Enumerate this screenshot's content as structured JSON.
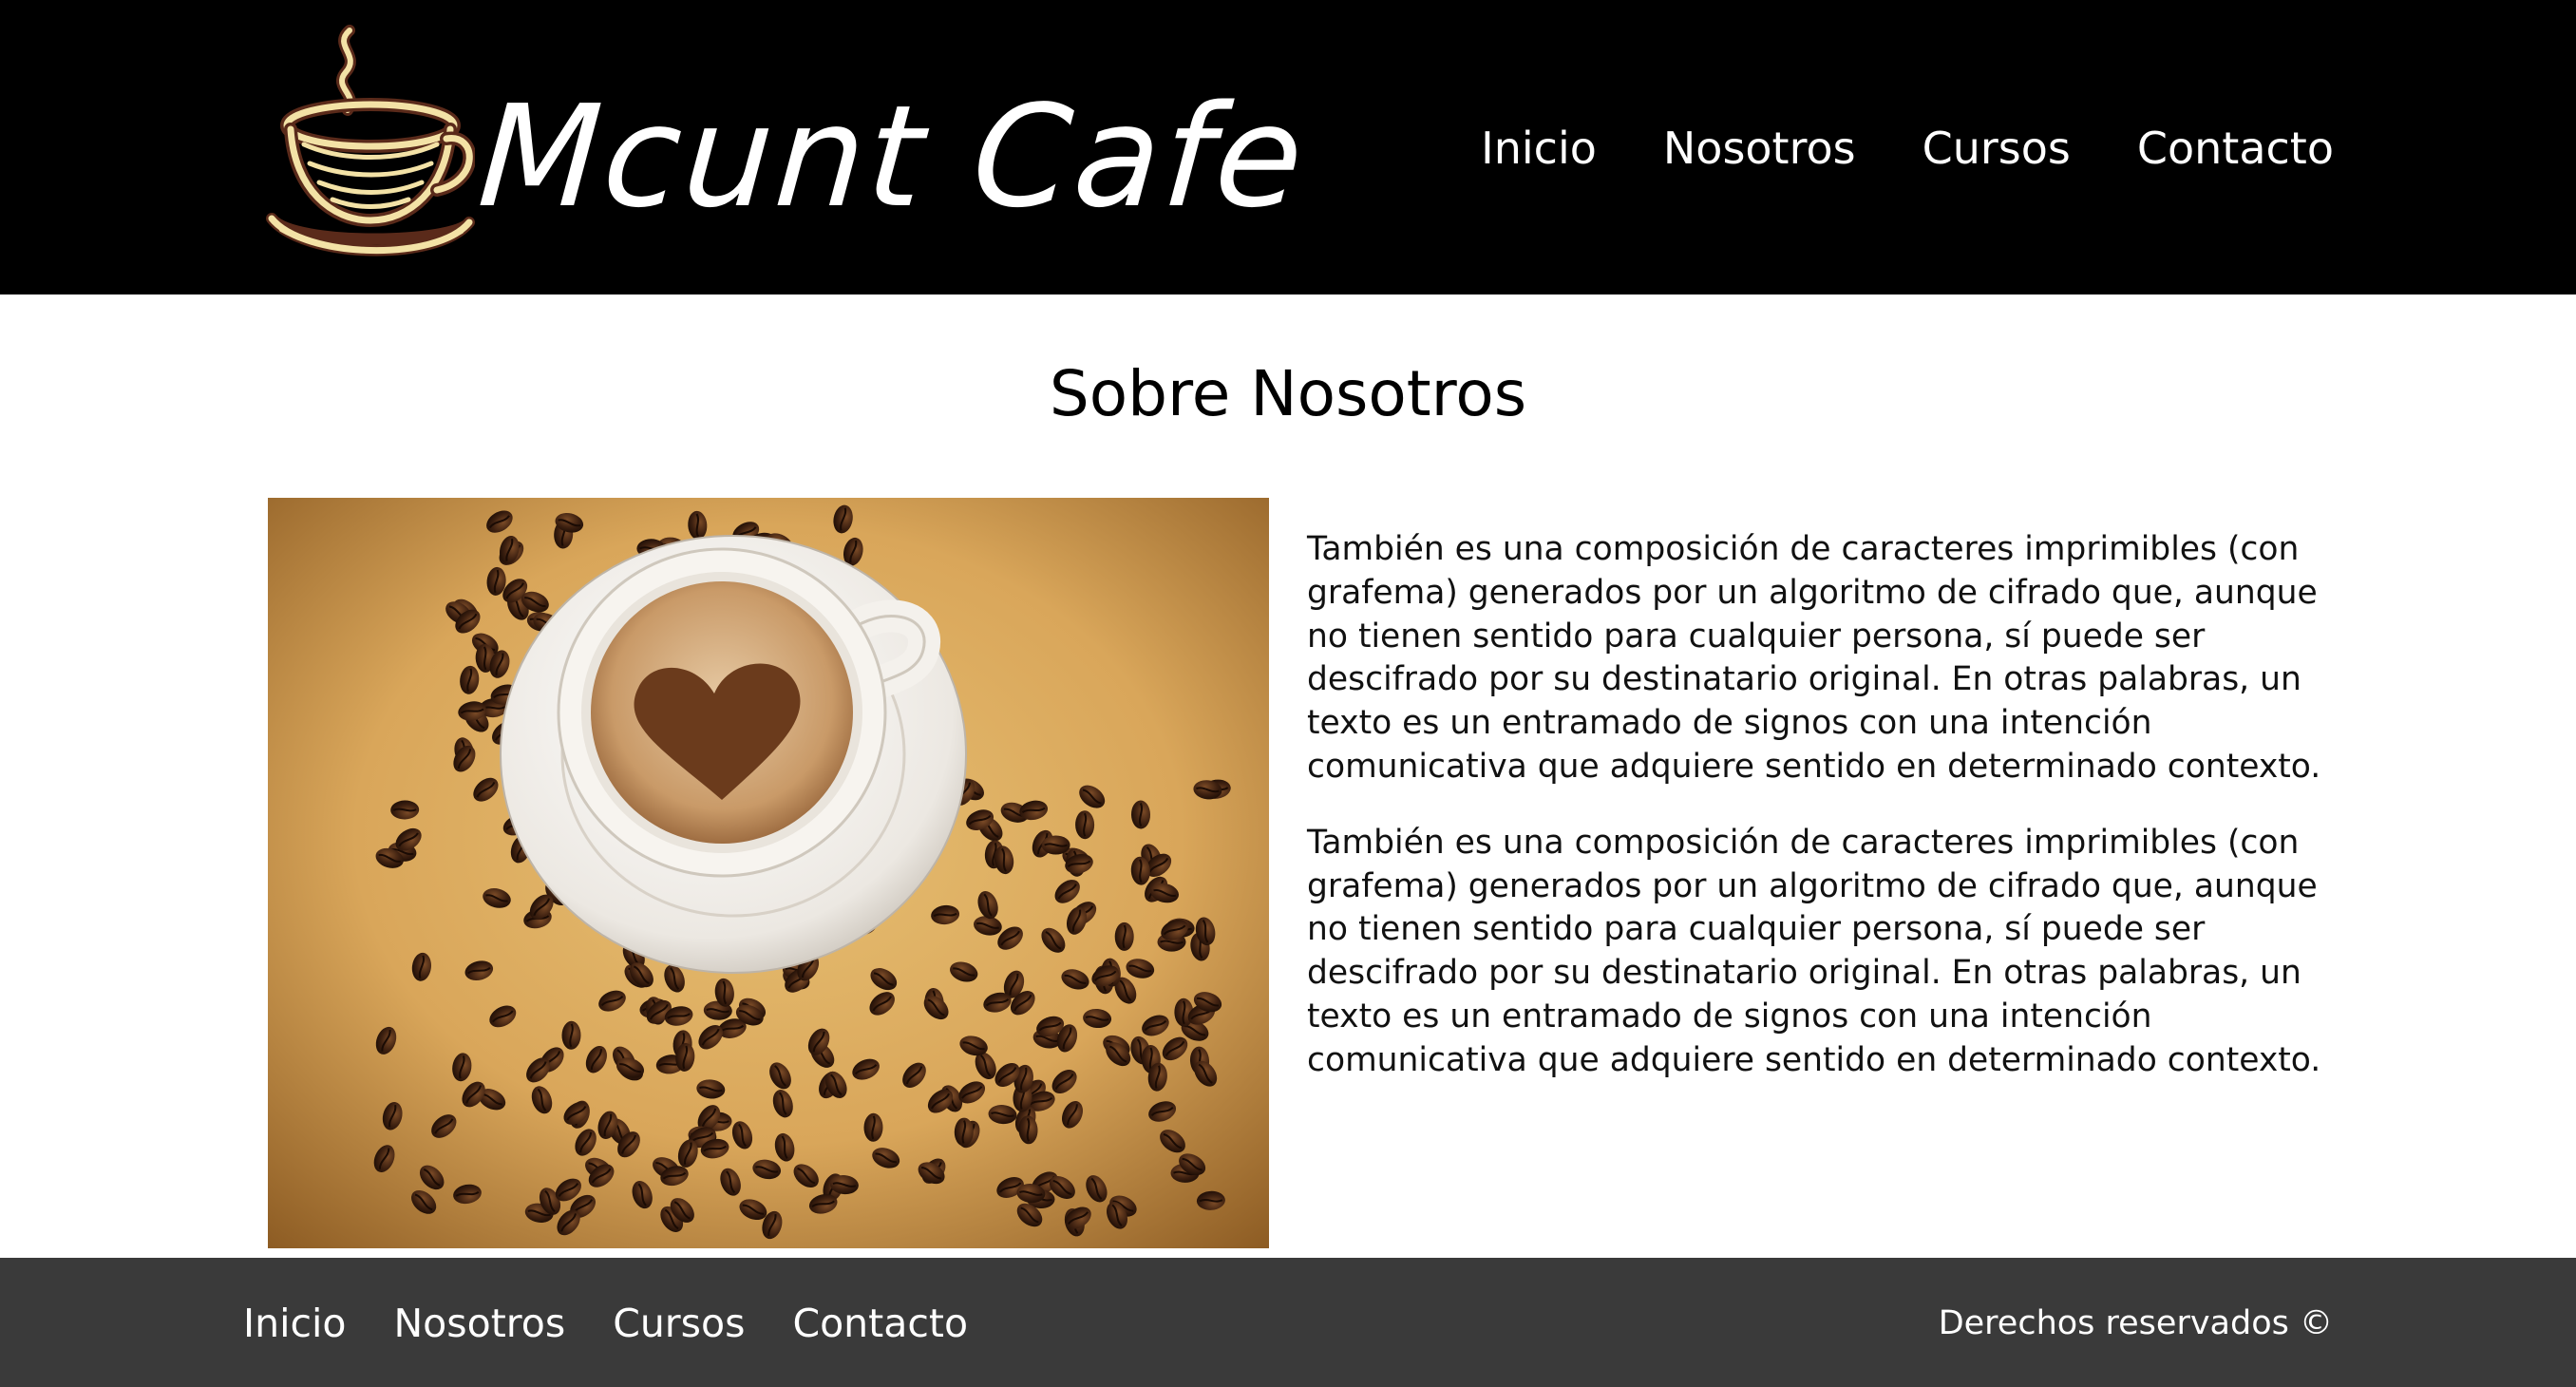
{
  "header": {
    "logo_text": "Mcunt Cafe",
    "logo_icon": "coffee-cup-icon",
    "nav": [
      {
        "label": "Inicio"
      },
      {
        "label": "Nosotros"
      },
      {
        "label": "Cursos"
      },
      {
        "label": "Contacto"
      }
    ]
  },
  "main": {
    "title": "Sobre Nosotros",
    "image_subject": "coffee-cup-with-heart-latte-art-and-coffee-beans",
    "paragraphs": [
      "También es una composición de caracteres imprimibles (con grafema) generados por un algoritmo de cifrado que, aunque no tienen sentido para cualquier persona, sí puede ser descifrado por su destinatario original. En otras palabras, un texto es un entramado de signos con una intención comunicativa que adquiere sentido en determinado contexto.",
      "También es una composición de caracteres imprimibles (con grafema) generados por un algoritmo de cifrado que, aunque no tienen sentido para cualquier persona, sí puede ser descifrado por su destinatario original. En otras palabras, un texto es un entramado de signos con una intención comunicativa que adquiere sentido en determinado contexto."
    ]
  },
  "footer": {
    "nav": [
      {
        "label": "Inicio"
      },
      {
        "label": "Nosotros"
      },
      {
        "label": "Cursos"
      },
      {
        "label": "Contacto"
      }
    ],
    "copyright": "Derechos reservados ©"
  },
  "colors": {
    "header_bg": "#000000",
    "footer_bg": "#3a3a3a",
    "logo_cup": "#f3e2a6",
    "logo_cup_shadow": "#5a2a1a"
  }
}
